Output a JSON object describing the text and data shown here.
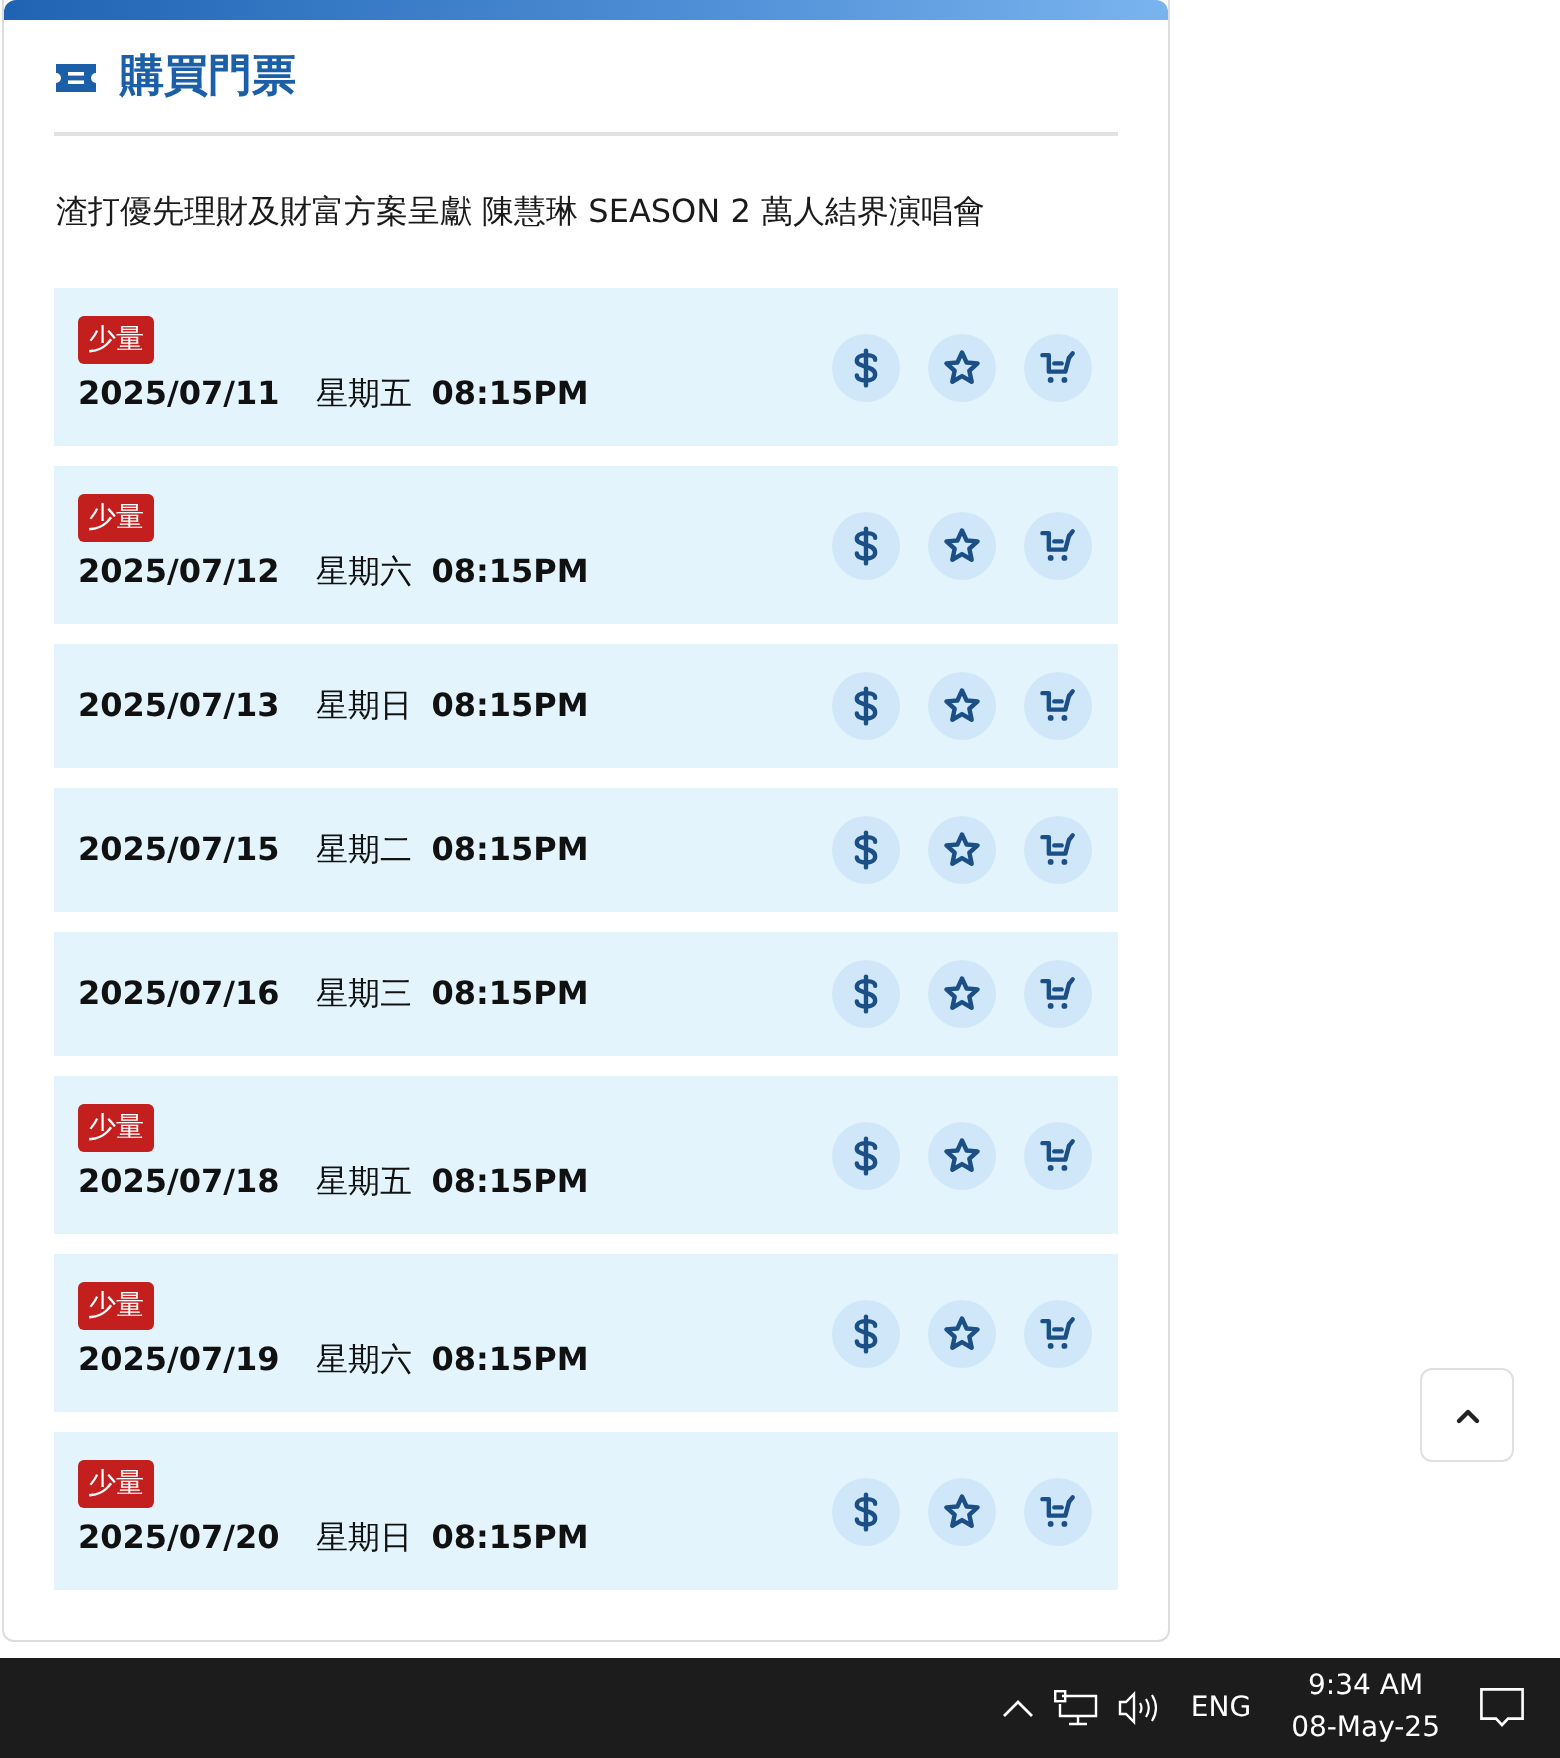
{
  "section": {
    "title": "購買門票",
    "subtitle": "渣打優先理財及財富方案呈獻 陳慧琳 SEASON 2 萬人結界演唱會"
  },
  "shows": [
    {
      "badge": "少量",
      "date": "2025/07/11",
      "weekday": "星期五",
      "time": "08:15PM"
    },
    {
      "badge": "少量",
      "date": "2025/07/12",
      "weekday": "星期六",
      "time": "08:15PM"
    },
    {
      "date": "2025/07/13",
      "weekday": "星期日",
      "time": "08:15PM"
    },
    {
      "date": "2025/07/15",
      "weekday": "星期二",
      "time": "08:15PM"
    },
    {
      "date": "2025/07/16",
      "weekday": "星期三",
      "time": "08:15PM"
    },
    {
      "badge": "少量",
      "date": "2025/07/18",
      "weekday": "星期五",
      "time": "08:15PM"
    },
    {
      "badge": "少量",
      "date": "2025/07/19",
      "weekday": "星期六",
      "time": "08:15PM"
    },
    {
      "badge": "少量",
      "date": "2025/07/20",
      "weekday": "星期日",
      "time": "08:15PM"
    }
  ],
  "taskbar": {
    "language": "ENG",
    "time": "9:34 AM",
    "date": "08-May-25"
  }
}
